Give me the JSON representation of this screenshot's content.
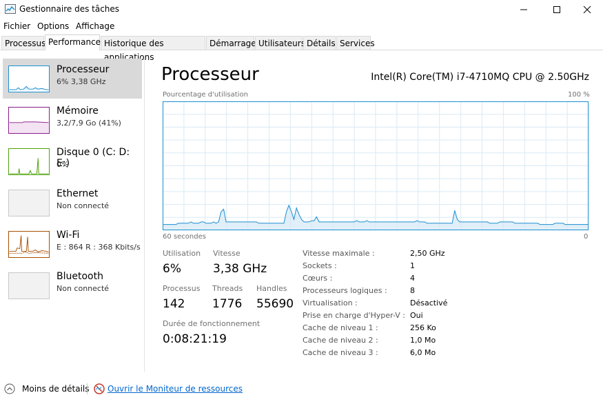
{
  "window": {
    "title": "Gestionnaire des tâches"
  },
  "menu": [
    "Fichier",
    "Options",
    "Affichage"
  ],
  "tabs": [
    {
      "label": "Processus"
    },
    {
      "label": "Performance"
    },
    {
      "label": "Historique des applications"
    },
    {
      "label": "Démarrage"
    },
    {
      "label": "Utilisateurs"
    },
    {
      "label": "Détails"
    },
    {
      "label": "Services"
    }
  ],
  "active_tab": "Performance",
  "sidebar": {
    "items": [
      {
        "title": "Processeur",
        "sub": "6% 3,38 GHz",
        "color": "#1a8ed0"
      },
      {
        "title": "Mémoire",
        "sub": "3,2/7,9 Go (41%)",
        "color": "#8b1a8b"
      },
      {
        "title": "Disque 0 (C: D: E:)",
        "sub": "0%",
        "color": "#4da20b"
      },
      {
        "title": "Ethernet",
        "sub": "Non connecté",
        "color": "#a0a0a0"
      },
      {
        "title": "Wi-Fi",
        "sub": "E : 864 R : 368 Kbits/s",
        "color": "#a74f01"
      },
      {
        "title": "Bluetooth",
        "sub": "Non connecté",
        "color": "#a0a0a0"
      }
    ]
  },
  "main": {
    "title": "Processeur",
    "cpu_name": "Intel(R) Core(TM) i7-4710MQ CPU @ 2.50GHz",
    "chart_top_left": "Pourcentage d'utilisation",
    "chart_top_right": "100 %",
    "chart_bottom_left": "60 secondes",
    "chart_bottom_right": "0",
    "stats": {
      "utilisation_label": "Utilisation",
      "utilisation": "6%",
      "vitesse_label": "Vitesse",
      "vitesse": "3,38 GHz",
      "processus_label": "Processus",
      "processus": "142",
      "threads_label": "Threads",
      "threads": "1776",
      "handles_label": "Handles",
      "handles": "55690",
      "duree_label": "Durée de fonctionnement",
      "duree": "0:08:21:19"
    },
    "details": [
      {
        "label": "Vitesse maximale :",
        "value": "2,50 GHz"
      },
      {
        "label": "Sockets :",
        "value": "1"
      },
      {
        "label": "Cœurs :",
        "value": "4"
      },
      {
        "label": "Processeurs logiques :",
        "value": "8"
      },
      {
        "label": "Virtualisation :",
        "value": "Désactivé"
      },
      {
        "label": "Prise en charge d'Hyper-V :",
        "value": "Oui"
      },
      {
        "label": "Cache de niveau 1 :",
        "value": "256 Ko"
      },
      {
        "label": "Cache de niveau 2 :",
        "value": "1,0 Mo"
      },
      {
        "label": "Cache de niveau 3 :",
        "value": "6,0 Mo"
      }
    ]
  },
  "footer": {
    "less_details": "Moins de détails",
    "resource_monitor": "Ouvrir le Moniteur de ressources"
  },
  "chart_data": {
    "type": "area",
    "y_range": [
      0,
      100
    ],
    "x_range_seconds": [
      60,
      0
    ],
    "cpu_usage_percent": [
      4,
      4,
      4,
      4,
      4,
      4,
      5,
      5,
      5,
      5,
      5,
      6,
      5,
      5,
      5,
      6,
      6,
      5,
      5,
      5,
      6,
      5,
      6,
      14,
      16,
      6,
      6,
      6,
      6,
      6,
      6,
      6,
      6,
      6,
      6,
      6,
      6,
      6,
      5,
      5,
      5,
      5,
      5,
      5,
      5,
      5,
      5,
      5,
      5,
      14,
      19,
      14,
      8,
      17,
      12,
      8,
      6,
      6,
      6,
      7,
      7,
      10,
      6,
      6,
      6,
      6,
      6,
      6,
      6,
      6,
      6,
      6,
      6,
      6,
      6,
      6,
      6,
      7,
      6,
      6,
      6,
      7,
      6,
      6,
      6,
      6,
      6,
      6,
      6,
      6,
      6,
      6,
      6,
      6,
      6,
      6,
      6,
      6,
      6,
      6,
      6,
      7,
      6,
      6,
      6,
      5,
      5,
      5,
      5,
      5,
      5,
      5,
      5,
      5,
      5,
      5,
      15,
      8,
      6,
      6,
      6,
      6,
      6,
      6,
      6,
      6,
      6,
      6,
      6,
      6,
      5,
      5,
      5,
      5,
      6,
      6,
      6,
      6,
      6,
      6,
      5,
      5,
      5,
      5,
      5,
      5,
      5,
      5,
      5,
      5,
      4,
      4,
      4,
      4,
      4,
      4,
      5,
      5,
      5,
      5,
      4,
      4,
      4,
      4,
      4,
      4,
      4,
      4,
      4,
      4
    ]
  }
}
